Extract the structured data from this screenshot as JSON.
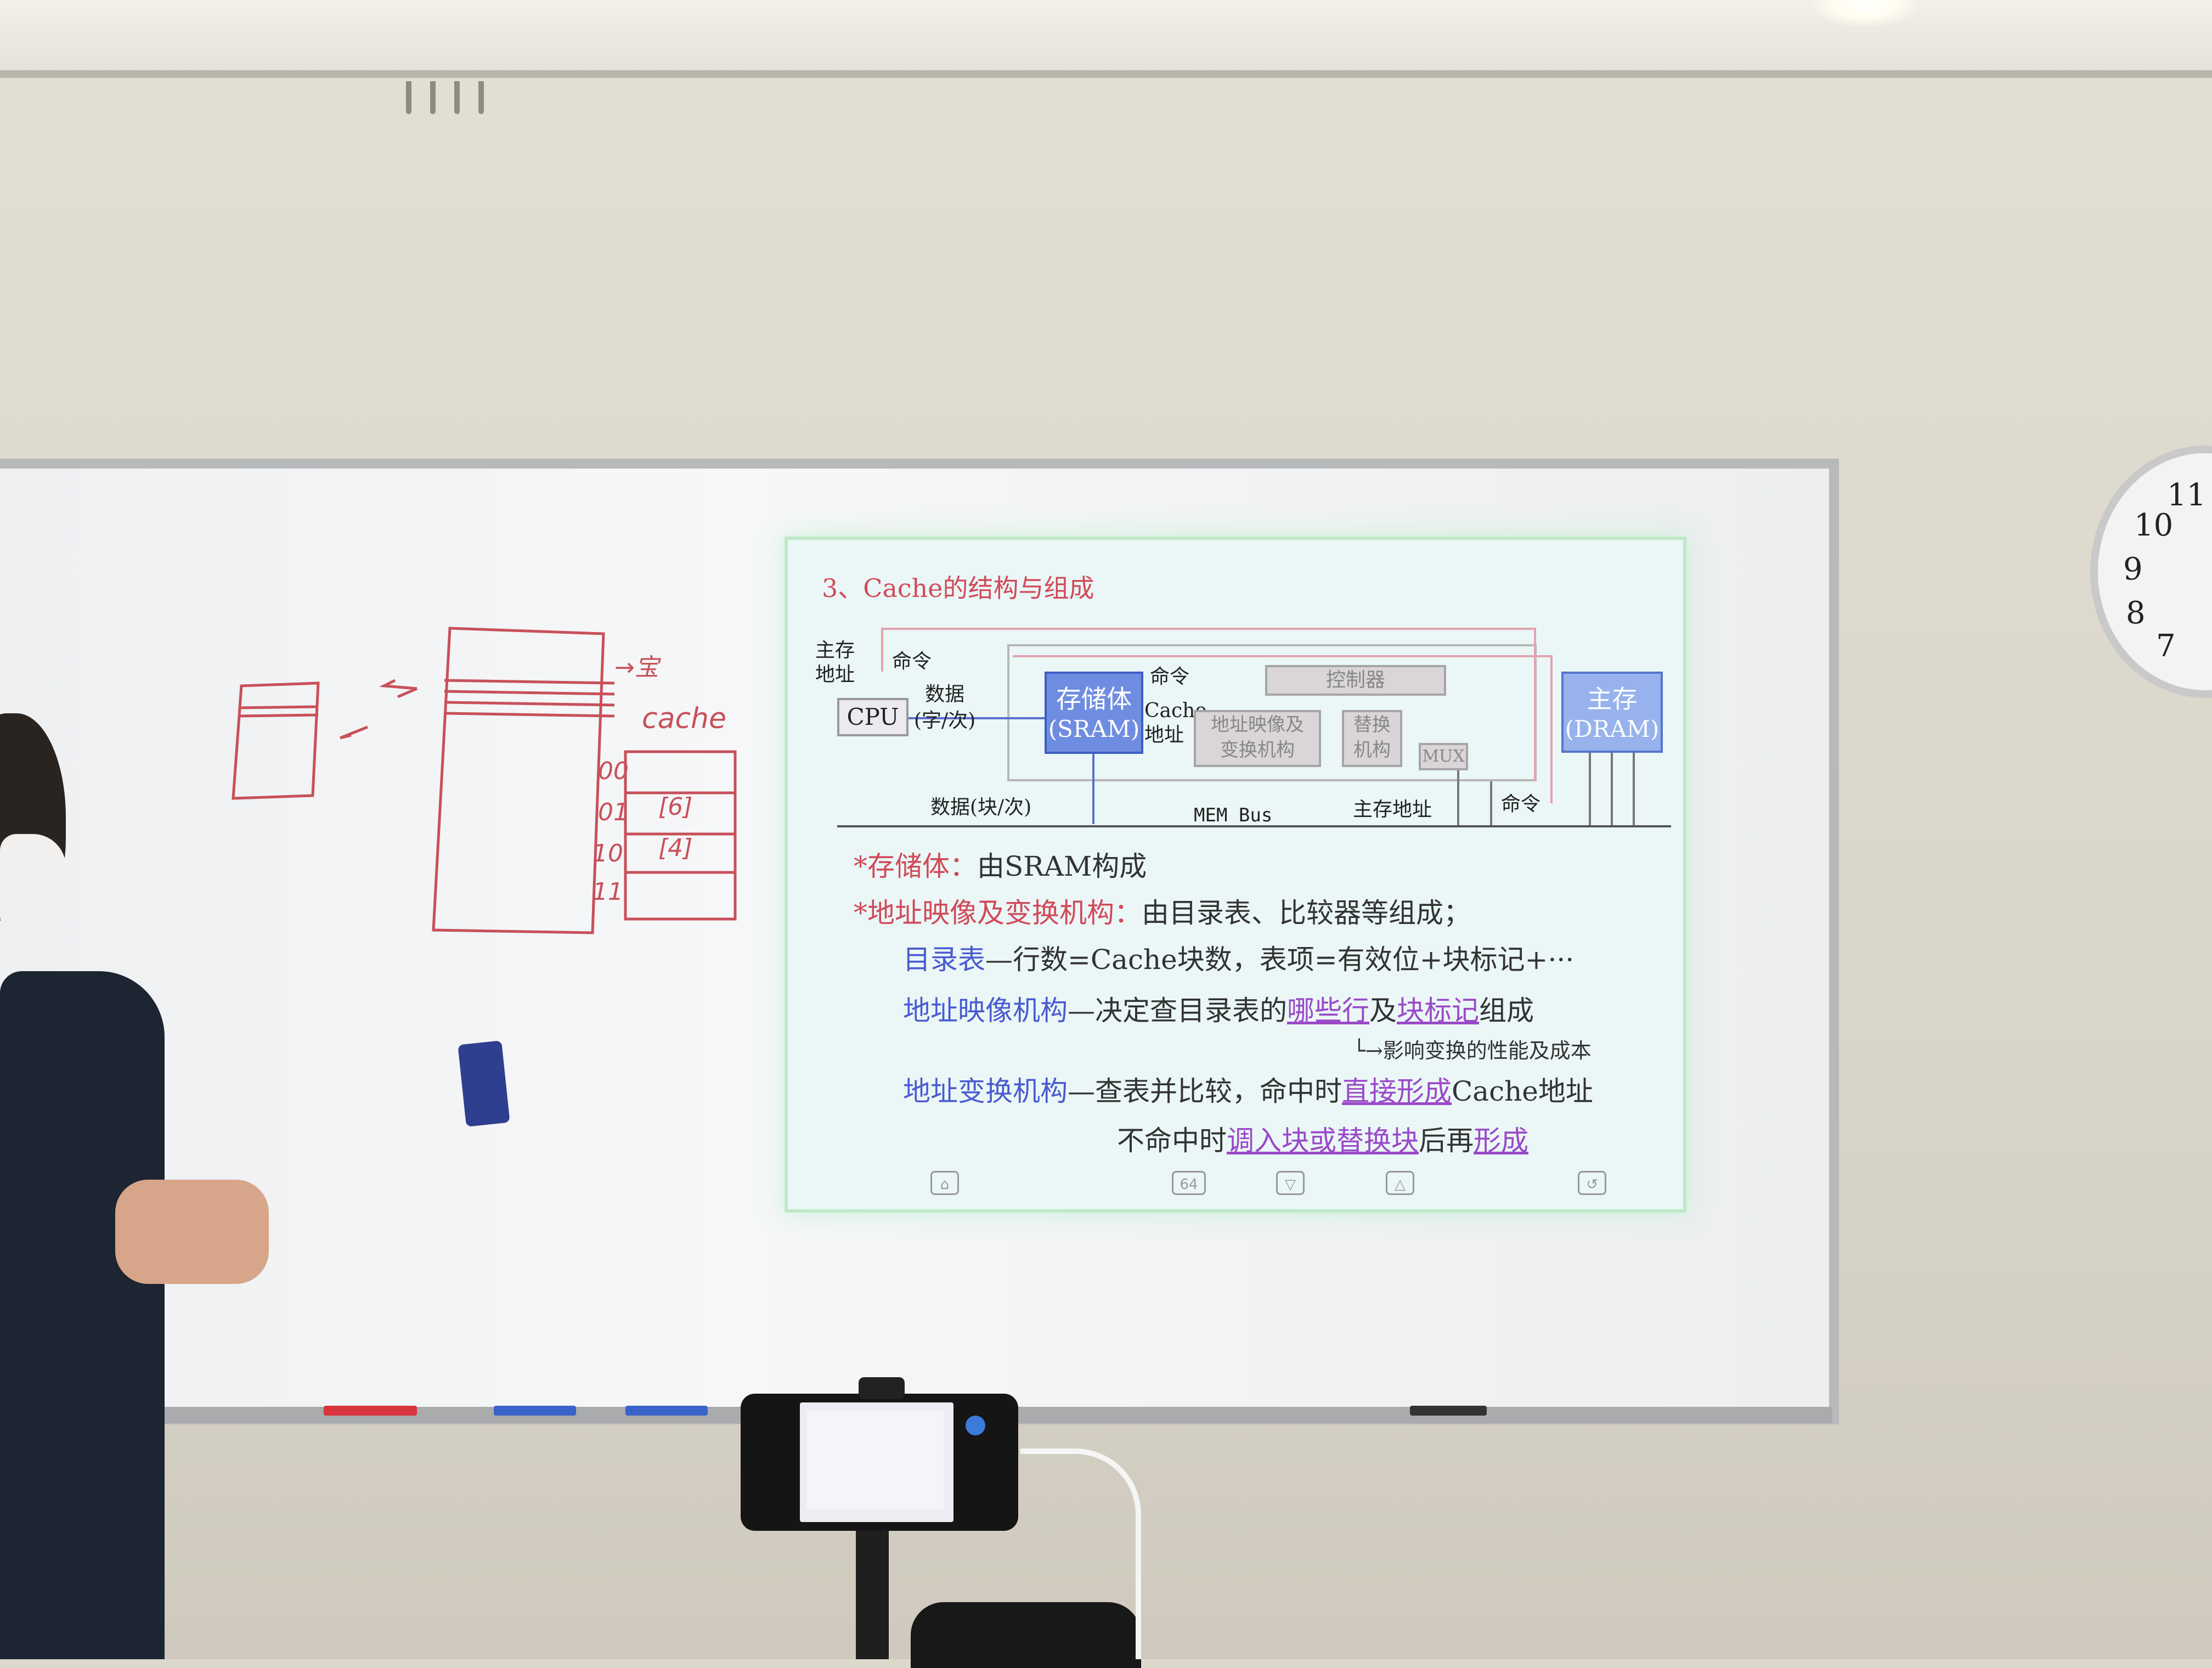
{
  "slide": {
    "title": "3、Cache的结构与组成",
    "diagram": {
      "main_address_label": "主存\n地址",
      "command_left": "命令",
      "cpu": "CPU",
      "data_word": "数据\n(字/次)",
      "storage_title": "存储体",
      "storage_sub": "(SRAM)",
      "command_top": "命令",
      "controller": "控制器",
      "cache_address": "Cache\n地址",
      "mapping": "地址映像及\n变换机构",
      "replace": "替换\n机构",
      "mux": "MUX",
      "main_memory_title": "主存",
      "main_memory_sub": "(DRAM)",
      "data_block": "数据(块/次)",
      "mem_bus": "MEM Bus",
      "main_address_bottom": "主存地址",
      "command_bottom": "命令"
    },
    "bullet1_prefix": "*存储体：",
    "bullet1_text": "由SRAM构成",
    "bullet2_prefix": "*地址映像及变换机构：",
    "bullet2_text": "由目录表、比较器等组成；",
    "line3_term": "目录表",
    "line3_text": "—行数=Cache块数，表项=有效位+块标记+···",
    "line4_term": "地址映像机构",
    "line4_mid": "—决定查目录表的",
    "line4_u1": "哪些行",
    "line4_and": "及",
    "line4_u2": "块标记",
    "line4_end": "组成",
    "line5_note": "└→影响变换的性能及成本",
    "line6_term": "地址变换机构",
    "line6_mid": "—查表并比较，命中时",
    "line6_u1": "直接形成",
    "line6_end": "Cache地址",
    "line7_start": "不命中时",
    "line7_u1": "调入块或替换块",
    "line7_mid": "后再",
    "line7_u2": "形成",
    "nav_page": "64"
  },
  "whiteboard": {
    "handwriting_cache": "cache",
    "handwriting_rows": [
      "00",
      "01",
      "10",
      "11"
    ],
    "handwriting_cells": [
      "",
      "[6]",
      "[4]",
      ""
    ],
    "handwriting_right": "→宝"
  },
  "clock": {
    "numbers": [
      "11",
      "10",
      "9",
      "8",
      "7"
    ]
  },
  "colors": {
    "slide_title": "#d14a5a",
    "slide_blue": "#4a5bd0",
    "underline_purple": "#9b49c9",
    "marker_red": "#c8505a"
  }
}
